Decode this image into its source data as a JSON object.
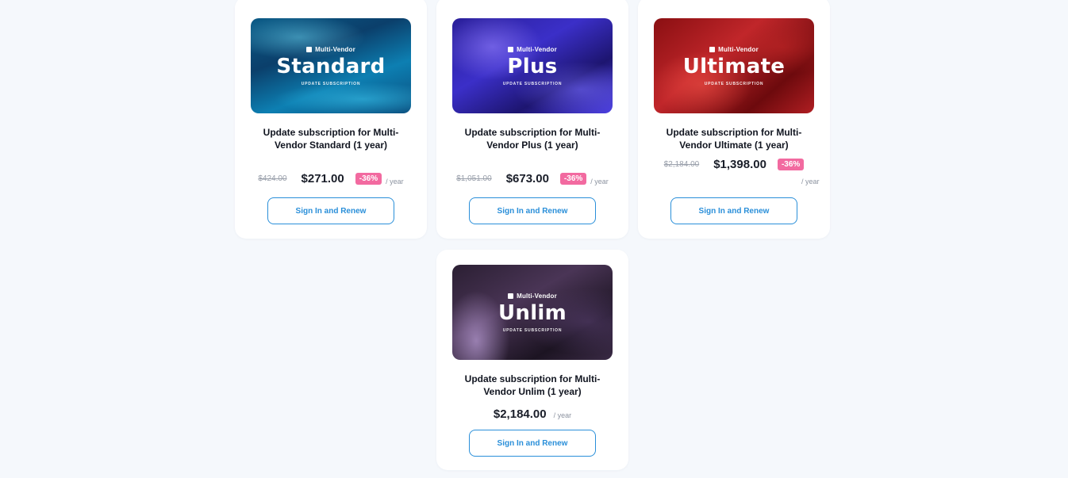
{
  "products": [
    {
      "brand": "Multi-Vendor",
      "edition": "Standard",
      "caption": "UPDATE SUBSCRIPTION",
      "title": "Update subscription for Multi-Vendor Standard (1 year)",
      "old_price": "$424.00",
      "price": "$271.00",
      "discount": "-36%",
      "period": "/ year",
      "button": "Sign In and Renew"
    },
    {
      "brand": "Multi-Vendor",
      "edition": "Plus",
      "caption": "UPDATE SUBSCRIPTION",
      "title": "Update subscription for Multi-Vendor Plus (1 year)",
      "old_price": "$1,051.00",
      "price": "$673.00",
      "discount": "-36%",
      "period": "/ year",
      "button": "Sign In and Renew"
    },
    {
      "brand": "Multi-Vendor",
      "edition": "Ultimate",
      "caption": "UPDATE SUBSCRIPTION",
      "title": "Update subscription for Multi-Vendor Ultimate (1 year)",
      "old_price": "$2,184.00",
      "price": "$1,398.00",
      "discount": "-36%",
      "period": "/ year",
      "button": "Sign In and Renew"
    },
    {
      "brand": "Multi-Vendor",
      "edition": "Unlim",
      "caption": "UPDATE SUBSCRIPTION",
      "title": "Update subscription for Multi-Vendor Unlim (1 year)",
      "price": "$2,184.00",
      "period": "/ year",
      "button": "Sign In and Renew"
    }
  ],
  "colors": {
    "button_accent": "#2a8fd9",
    "discount_badge": "#f26aa0",
    "page_background": "#f5f8fc"
  }
}
